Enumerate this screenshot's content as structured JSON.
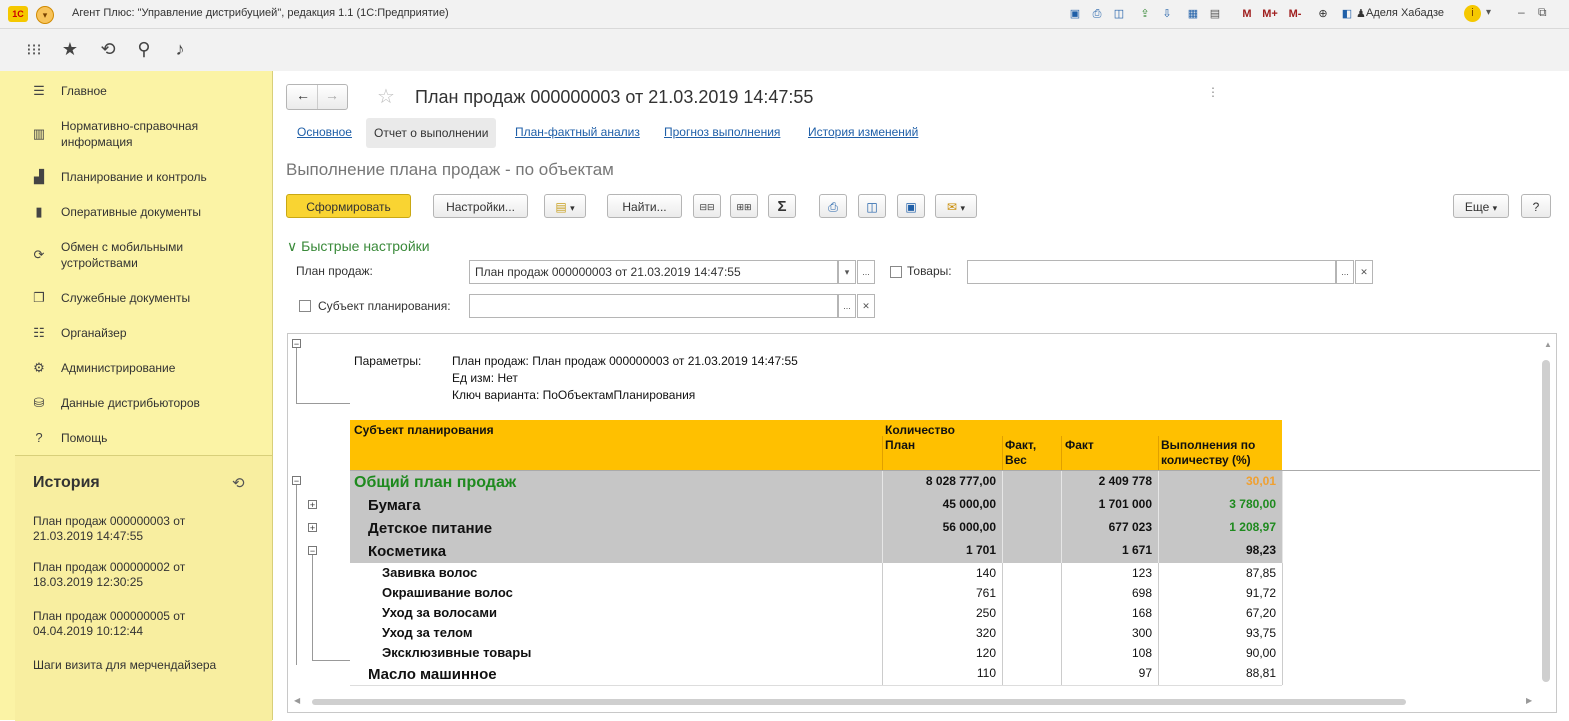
{
  "window": {
    "app_title": "Агент Плюс: \"Управление дистрибуцией\", редакция 1.1  (1С:Предприятие)",
    "logo_text": "1С",
    "user": "Аделя Хабадзе",
    "toolbar_icons": [
      "save-icon",
      "print-icon",
      "preview-icon",
      "upload-icon",
      "download-icon",
      "calc-icon",
      "calendar-icon",
      "m-memory",
      "m-plus",
      "m-minus",
      "zoom-icon",
      "window-icon"
    ],
    "m": "M",
    "mplus": "M+",
    "mminus": "M-"
  },
  "sidebar": {
    "items": [
      {
        "label": "Главное",
        "icon": "menu-icon"
      },
      {
        "label": "Нормативно-справочная информация",
        "icon": "catalog-icon"
      },
      {
        "label": "Планирование и контроль",
        "icon": "chart-icon"
      },
      {
        "label": "Оперативные документы",
        "icon": "document-icon"
      },
      {
        "label": "Обмен с мобильными устройствами",
        "icon": "sync-icon"
      },
      {
        "label": "Служебные документы",
        "icon": "documents-icon"
      },
      {
        "label": "Органайзер",
        "icon": "organizer-icon"
      },
      {
        "label": "Администрирование",
        "icon": "gear-icon"
      },
      {
        "label": "Данные дистрибьюторов",
        "icon": "distributor-icon"
      },
      {
        "label": "Помощь",
        "icon": "help-icon"
      }
    ],
    "history_title": "История",
    "history": [
      "План продаж 000000003 от 21.03.2019 14:47:55",
      "План продаж 000000002 от 18.03.2019 12:30:25",
      "План продаж 000000005 от 04.04.2019 10:12:44",
      "Шаги визита для мерчендайзера"
    ]
  },
  "document": {
    "title": "План продаж 000000003 от 21.03.2019 14:47:55",
    "tabs": [
      "Основное",
      "Отчет о выполнении",
      "План-фактный анализ",
      "Прогноз выполнения",
      "История изменений"
    ],
    "active_tab": "Отчет о выполнении",
    "subtitle": "Выполнение плана продаж - по объектам"
  },
  "toolbar": {
    "generate": "Сформировать",
    "settings": "Настройки...",
    "find": "Найти...",
    "sum": "Σ",
    "more": "Еще",
    "help": "?"
  },
  "quick_settings": {
    "title": "Быстрые настройки",
    "plan_label": "План продаж:",
    "plan_value": "План продаж 000000003 от 21.03.2019 14:47:55",
    "goods_label": "Товары:",
    "goods_value": "",
    "subject_label": "Субъект планирования:",
    "subject_value": ""
  },
  "report": {
    "params_label": "Параметры:",
    "params": [
      "План продаж: План продаж 000000003 от 21.03.2019 14:47:55",
      "Ед изм: Нет",
      "Ключ варианта: ПоОбъектамПланирования"
    ],
    "headers": {
      "subject": "Субъект планирования",
      "quantity": "Количество",
      "plan": "План",
      "fact_weight": "Факт, Вес",
      "fact": "Факт",
      "completion": "Выполнения по количеству (%)"
    },
    "rows": [
      {
        "name": "Общий план продаж",
        "plan": "8 028 777,00",
        "fact_weight": "",
        "fact": "2 409 778",
        "pct": "30,01",
        "level": 0
      },
      {
        "name": "Бумага",
        "plan": "45 000,00",
        "fact_weight": "",
        "fact": "1 701 000",
        "pct": "3 780,00",
        "level": 1
      },
      {
        "name": "Детское питание",
        "plan": "56 000,00",
        "fact_weight": "",
        "fact": "677 023",
        "pct": "1 208,97",
        "level": 1
      },
      {
        "name": "Косметика",
        "plan": "1 701",
        "fact_weight": "",
        "fact": "1 671",
        "pct": "98,23",
        "level": 1
      },
      {
        "name": "Завивка волос",
        "plan": "140",
        "fact_weight": "",
        "fact": "123",
        "pct": "87,85",
        "level": 2
      },
      {
        "name": "Окрашивание волос",
        "plan": "761",
        "fact_weight": "",
        "fact": "698",
        "pct": "91,72",
        "level": 2
      },
      {
        "name": "Уход за волосами",
        "plan": "250",
        "fact_weight": "",
        "fact": "168",
        "pct": "67,20",
        "level": 2
      },
      {
        "name": "Уход за телом",
        "plan": "320",
        "fact_weight": "",
        "fact": "300",
        "pct": "93,75",
        "level": 2
      },
      {
        "name": "Эксклюзивные товары",
        "plan": "120",
        "fact_weight": "",
        "fact": "108",
        "pct": "90,00",
        "level": 2
      },
      {
        "name": "Масло машинное",
        "plan": "110",
        "fact_weight": "",
        "fact": "97",
        "pct": "88,81",
        "level": 1
      }
    ]
  },
  "colors": {
    "header_bg": "#ffc000",
    "group_bg": "#c6c6c6",
    "green_text": "#1e8a1e",
    "orange_text": "#f0a030",
    "sidebar_bg": "#fbf3a5",
    "primary_button": "#f9d432"
  }
}
